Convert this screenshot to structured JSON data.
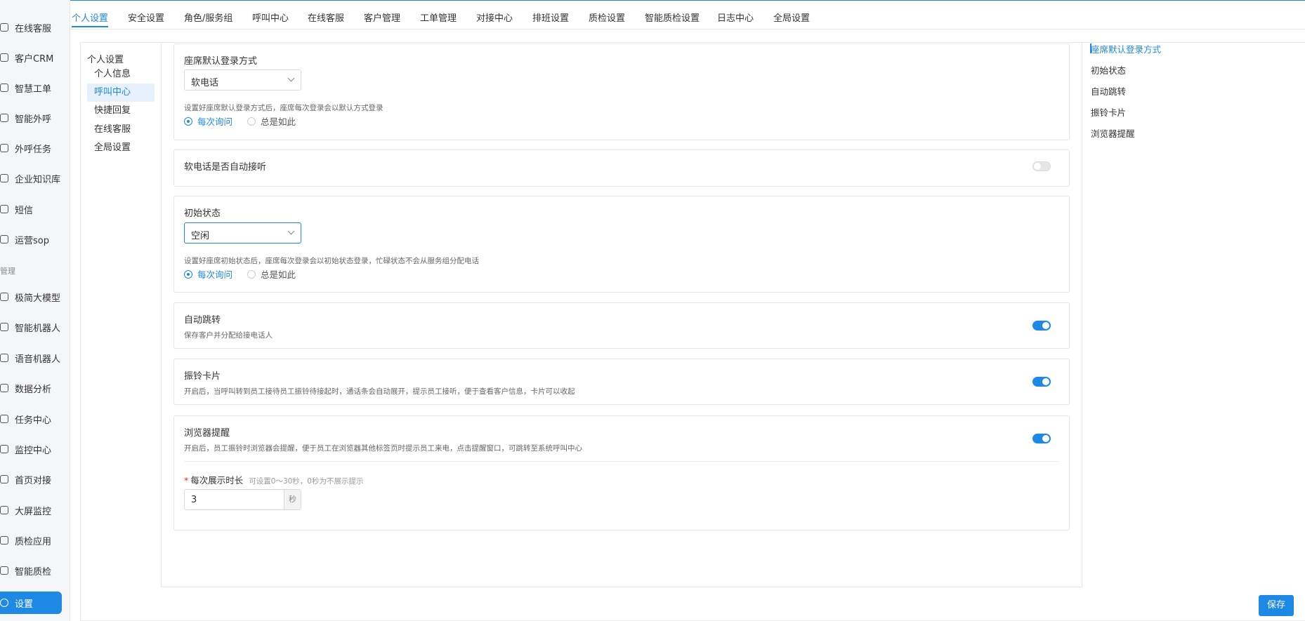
{
  "sidebar": {
    "items": [
      {
        "label": "在线客服",
        "icon": "headset-icon"
      },
      {
        "label": "客户CRM",
        "icon": "user-icon"
      },
      {
        "label": "智慧工单",
        "icon": "document-icon"
      },
      {
        "label": "智能外呼",
        "icon": "phone-icon"
      },
      {
        "label": "外呼任务",
        "icon": "phone-task-icon"
      },
      {
        "label": "企业知识库",
        "icon": "book-icon"
      },
      {
        "label": "短信",
        "icon": "message-icon"
      },
      {
        "label": "运营sop",
        "icon": "flow-icon"
      }
    ],
    "group_label": "管理",
    "items2": [
      {
        "label": "极简大模型",
        "icon": "model-icon"
      },
      {
        "label": "智能机器人",
        "icon": "robot-icon"
      },
      {
        "label": "语音机器人",
        "icon": "voice-robot-icon"
      },
      {
        "label": "数据分析",
        "icon": "chart-icon"
      },
      {
        "label": "任务中心",
        "icon": "task-icon"
      },
      {
        "label": "监控中心",
        "icon": "monitor-icon"
      },
      {
        "label": "首页对接",
        "icon": "home-link-icon"
      },
      {
        "label": "大屏监控",
        "icon": "screen-icon"
      },
      {
        "label": "质检应用",
        "icon": "quality-icon"
      },
      {
        "label": "智能质检",
        "icon": "smart-quality-icon"
      }
    ],
    "active": {
      "label": "设置",
      "icon": "gear-icon"
    }
  },
  "tabs": [
    "个人设置",
    "安全设置",
    "角色/服务组",
    "呼叫中心",
    "在线客服",
    "客户管理",
    "工单管理",
    "对接中心",
    "排班设置",
    "质检设置",
    "智能质检设置",
    "日志中心",
    "全局设置"
  ],
  "subnav": {
    "title": "个人设置",
    "items": [
      "个人信息",
      "呼叫中心",
      "快捷回复",
      "在线客服",
      "全局设置"
    ]
  },
  "sections": {
    "login": {
      "title": "座席默认登录方式",
      "select_value": "软电话",
      "desc": "设置好座席默认登录方式后，座席每次登录会以默认方式登录",
      "radio_ask": "每次询问",
      "radio_always": "总是如此"
    },
    "auto_answer": {
      "title": "软电话是否自动接听"
    },
    "initial": {
      "title": "初始状态",
      "select_value": "空闲",
      "desc": "设置好座席初始状态后，座席每次登录会以初始状态登录，忙碌状态不会从服务组分配电话",
      "radio_ask": "每次询问",
      "radio_always": "总是如此"
    },
    "auto_transfer": {
      "title": "自动跳转",
      "desc": "保存客户并分配给接电话人"
    },
    "ring_card": {
      "title": "振铃卡片",
      "desc": "开启后，当呼叫转到员工接待员工振铃待接起时，通话条会自动展开，提示员工接听，便于查看客户信息，卡片可以收起"
    },
    "browser_alert": {
      "title": "浏览器提醒",
      "desc": "开启后，员工振铃时浏览器会提醒，便于员工在浏览器其他标签页时提示员工来电，点击提醒窗口，可跳转至系统呼叫中心",
      "duration_label": "每次展示时长",
      "duration_hint": "可设置0～30秒，0秒为不展示提示",
      "duration_value": "3",
      "duration_unit": "秒"
    }
  },
  "anchor": [
    "座席默认登录方式",
    "初始状态",
    "自动跳转",
    "振铃卡片",
    "浏览器提醒"
  ],
  "save_label": "保存",
  "colors": {
    "accent": "#1e88e5"
  }
}
